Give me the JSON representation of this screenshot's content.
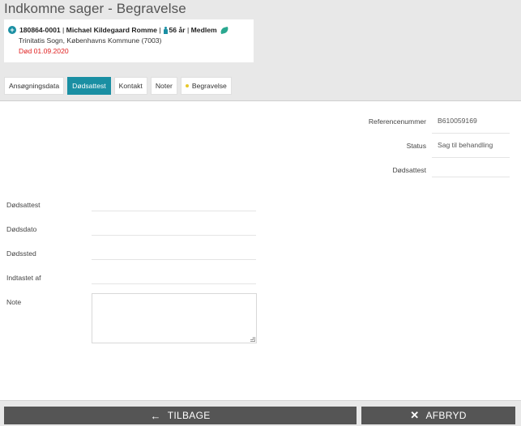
{
  "header": {
    "title": "Indkomne sager - Begravelse"
  },
  "case": {
    "id": "180864-0001",
    "name": "Michael Kildegaard Romme",
    "age": "56 år",
    "membership": "Medlem",
    "parish": "Trinitatis Sogn, Københavns Kommune (7003)",
    "death": "Død 01.09.2020"
  },
  "tabs": [
    {
      "label": "Ansøgningsdata"
    },
    {
      "label": "Dødsattest"
    },
    {
      "label": "Kontakt"
    },
    {
      "label": "Noter"
    },
    {
      "label": "Begravelse"
    }
  ],
  "details": {
    "reference_label": "Referencenummer",
    "reference_value": "B610059169",
    "status_label": "Status",
    "status_value": "Sag til behandling",
    "certificate_label": "Dødsattest",
    "certificate_value": ""
  },
  "form": {
    "certificate_label": "Dødsattest",
    "death_date_label": "Dødsdato",
    "death_place_label": "Dødssted",
    "entered_by_label": "Indtastet af",
    "note_label": "Note"
  },
  "footer": {
    "back_label": "TILBAGE",
    "cancel_label": "AFBRYD"
  },
  "colors": {
    "accent": "#1a8fa3",
    "death_text": "#e02020",
    "button": "#555555",
    "background": "#e8e8e8"
  },
  "icons": {
    "plus": "plus-circle-icon",
    "person": "person-icon",
    "membership": "leaf-icon",
    "back": "arrow-left-icon",
    "cancel": "close-icon"
  }
}
